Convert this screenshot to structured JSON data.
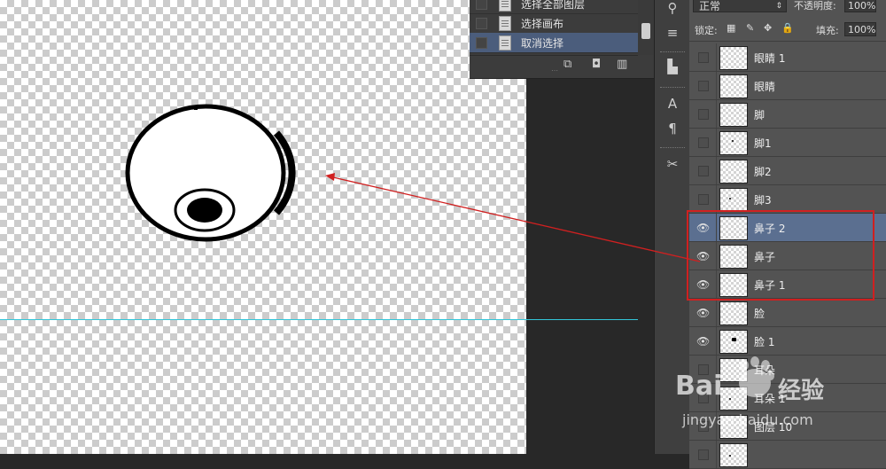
{
  "history_panel": {
    "items": [
      {
        "label": "选择全部图层"
      },
      {
        "label": "选择画布"
      },
      {
        "label": "取消选择"
      }
    ],
    "footer_icons": [
      "new-snapshot-icon",
      "camera-icon",
      "trash-icon"
    ]
  },
  "layers_panel": {
    "blend_mode": "正常",
    "opacity_label": "不透明度:",
    "opacity_value": "100%",
    "lock_label": "锁定:",
    "fill_label": "填充:",
    "fill_value": "100%",
    "layers": [
      {
        "name": "眼睛 1",
        "visible": false,
        "selected": false
      },
      {
        "name": "眼睛",
        "visible": false,
        "selected": false
      },
      {
        "name": "脚",
        "visible": false,
        "selected": false
      },
      {
        "name": "脚1",
        "visible": false,
        "selected": false
      },
      {
        "name": "脚2",
        "visible": false,
        "selected": false
      },
      {
        "name": "脚3",
        "visible": false,
        "selected": false
      },
      {
        "name": "鼻子 2",
        "visible": true,
        "selected": true
      },
      {
        "name": "鼻子",
        "visible": true,
        "selected": false
      },
      {
        "name": "鼻子 1",
        "visible": true,
        "selected": false
      },
      {
        "name": "脸",
        "visible": true,
        "selected": false
      },
      {
        "name": "脸 1",
        "visible": true,
        "selected": false
      },
      {
        "name": "耳朵",
        "visible": false,
        "selected": false
      },
      {
        "name": "耳朵 1",
        "visible": false,
        "selected": false
      },
      {
        "name": "图层 10",
        "visible": false,
        "selected": false
      },
      {
        "name": "",
        "visible": false,
        "selected": false
      }
    ]
  },
  "tools": [
    "play-icon",
    "brush-settings-icon",
    "clone-source-icon",
    "text-icon",
    "paragraph-icon",
    "scissors-icon"
  ],
  "watermark": {
    "brand_prefix": "Bai",
    "brand_suffix": "经验",
    "url": "jingyan.baidu.com"
  },
  "colors": {
    "annotation": "#d02020",
    "guide": "#33c6d8",
    "selected_layer": "#5b6f90"
  }
}
